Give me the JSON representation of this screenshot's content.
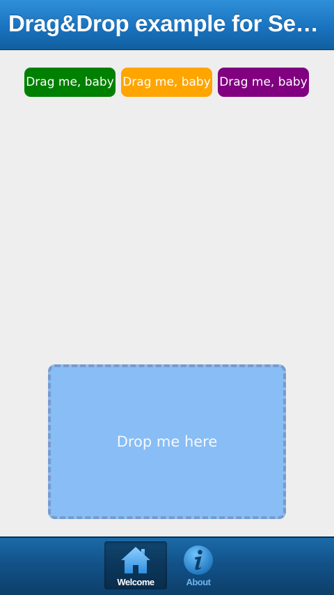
{
  "header": {
    "title": "Drag&Drop example for Sencha Touch"
  },
  "draggables": [
    {
      "label": "Drag me, baby",
      "color": "#008000"
    },
    {
      "label": "Drag me, baby",
      "color": "#ffa500"
    },
    {
      "label": "Drag me, baby",
      "color": "#800080"
    }
  ],
  "drop_zone": {
    "label": "Drop me here",
    "fill_color": "#88bdf5"
  },
  "tabbar": {
    "tabs": [
      {
        "label": "Welcome",
        "icon": "home-icon",
        "active": true
      },
      {
        "label": "About",
        "icon": "info-icon",
        "active": false
      }
    ]
  },
  "colors": {
    "accent": "#1a73bf",
    "background": "#eeeeee"
  }
}
